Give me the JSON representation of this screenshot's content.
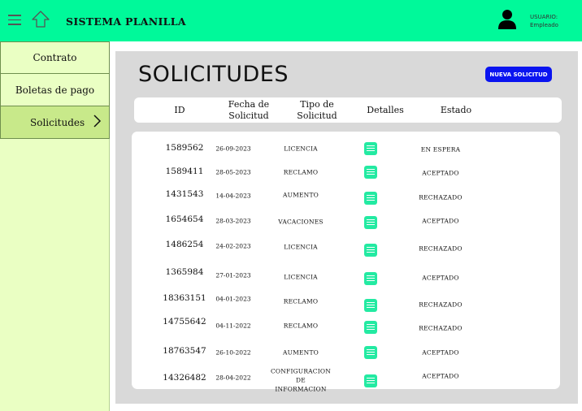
{
  "header": {
    "title": "SISTEMA PLANILLA",
    "user_label": "USUARIO:",
    "user_role": "Empleado"
  },
  "sidebar": {
    "items": [
      {
        "label": "Contrato"
      },
      {
        "label": "Boletas de pago"
      },
      {
        "label": "Solicitudes",
        "active": true
      }
    ]
  },
  "main": {
    "title": "SOLICITUDES",
    "new_button": "NUEVA SOLICITUD",
    "columns": {
      "id": "ID",
      "date": "Fecha de\nSolicitud",
      "type": "Tipo de\nSolicitud",
      "details": "Detalles",
      "state": "Estado"
    },
    "rows": [
      {
        "id": "1589562",
        "date": "26-09-2023",
        "type": "LICENCIA",
        "state": "EN ESPERA"
      },
      {
        "id": "1589411",
        "date": "28-05-2023",
        "type": "RECLAMO",
        "state": "ACEPTADO"
      },
      {
        "id": "1431543",
        "date": "14-04-2023",
        "type": "AUMENTO",
        "state": "RECHAZADO"
      },
      {
        "id": "1654654",
        "date": "28-03-2023",
        "type": "VACACIONES",
        "state": "ACEPTADO"
      },
      {
        "id": "1486254",
        "date": "24-02-2023",
        "type": "LICENCIA",
        "state": "RECHAZADO"
      },
      {
        "id": "1365984",
        "date": "27-01-2023",
        "type": "LICENCIA",
        "state": "ACEPTADO"
      },
      {
        "id": "18363151",
        "date": "04-01-2023",
        "type": "RECLAMO",
        "state": "RECHAZADO"
      },
      {
        "id": "14755642",
        "date": "04-11-2022",
        "type": "RECLAMO",
        "state": "RECHAZADO"
      },
      {
        "id": "18763547",
        "date": "26-10-2022",
        "type": "AUMENTO",
        "state": "ACEPTADO"
      },
      {
        "id": "14326482",
        "date": "28-04-2022",
        "type": "CONFIGURACION\nDE INFORMACION",
        "state": "ACEPTADO"
      }
    ]
  },
  "colors": {
    "header": "#00f99a",
    "sidebar": "#eaffc3",
    "sidebar_active": "#c8e98a",
    "button": "#0a14f0",
    "details_icon": "#23eaa2"
  },
  "icons": [
    "menu-icon",
    "home-icon",
    "user-icon",
    "chevron-right-icon",
    "document-icon"
  ]
}
